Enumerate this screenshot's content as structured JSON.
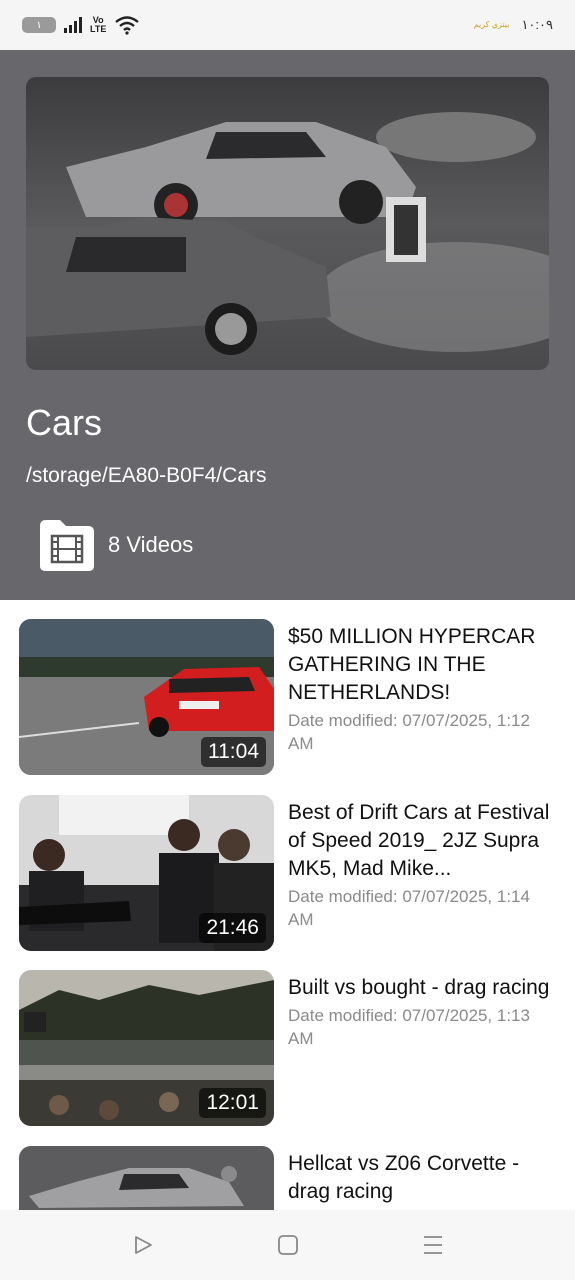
{
  "status_bar": {
    "battery_level": "١",
    "network": "Vo LTE",
    "carrier": "بيتزي كريم",
    "time": "١٠:٠٩"
  },
  "folder": {
    "title": "Cars",
    "path": "/storage/EA80-B0F4/Cars",
    "count_label": "8 Videos"
  },
  "videos": [
    {
      "title": "$50 MILLION HYPERCAR GATHERING IN THE NETHERLANDS!",
      "date": "Date modified: 07/07/2025, 1:12 AM",
      "duration": "11:04"
    },
    {
      "title": "Best of Drift Cars at Festival of Speed 2019_ 2JZ Supra MK5, Mad Mike...",
      "date": "Date modified: 07/07/2025, 1:14 AM",
      "duration": "21:46"
    },
    {
      "title": "Built vs bought - drag racing",
      "date": "Date modified: 07/07/2025, 1:13 AM",
      "duration": "12:01"
    },
    {
      "title": "Hellcat vs Z06 Corvette - drag racing",
      "date": "",
      "duration": ""
    }
  ],
  "icons": {
    "folder": "folder-video-icon",
    "nav_back": "triangle-back-icon",
    "nav_home": "square-home-icon",
    "nav_menu": "menu-lines-icon"
  },
  "colors": {
    "header_bg": "#68676b",
    "nav_bg": "#f7f7f7"
  }
}
